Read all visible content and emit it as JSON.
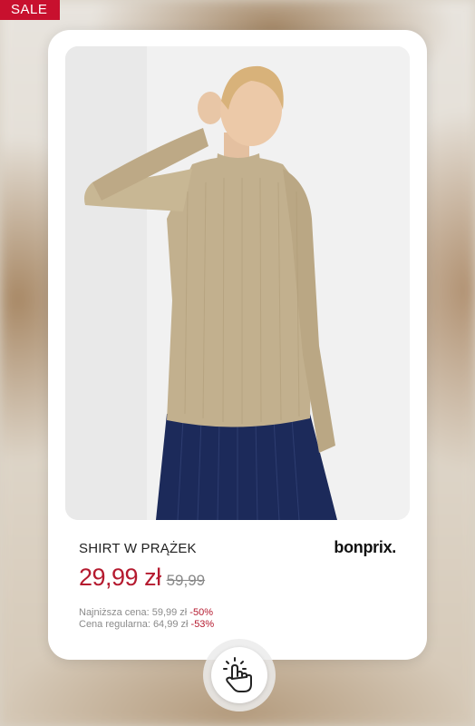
{
  "badge": {
    "sale_label": "SALE"
  },
  "product": {
    "name": "SHIRT W PRĄŻEK",
    "brand": "bonprix.",
    "price_current": "29,99 zł",
    "price_old": "59,99",
    "lowest_price_label": "Najniższa cena: 59,99 zł",
    "lowest_price_discount": "-50%",
    "regular_price_label": "Cena regularna: 64,99 zł",
    "regular_price_discount": "-53%"
  },
  "icons": {
    "tap": "tap-hand-icon"
  },
  "colors": {
    "sale_red": "#c8102e",
    "price_red": "#b51a2f",
    "sweater": "#c2b08e",
    "trousers": "#1c2a5a"
  }
}
